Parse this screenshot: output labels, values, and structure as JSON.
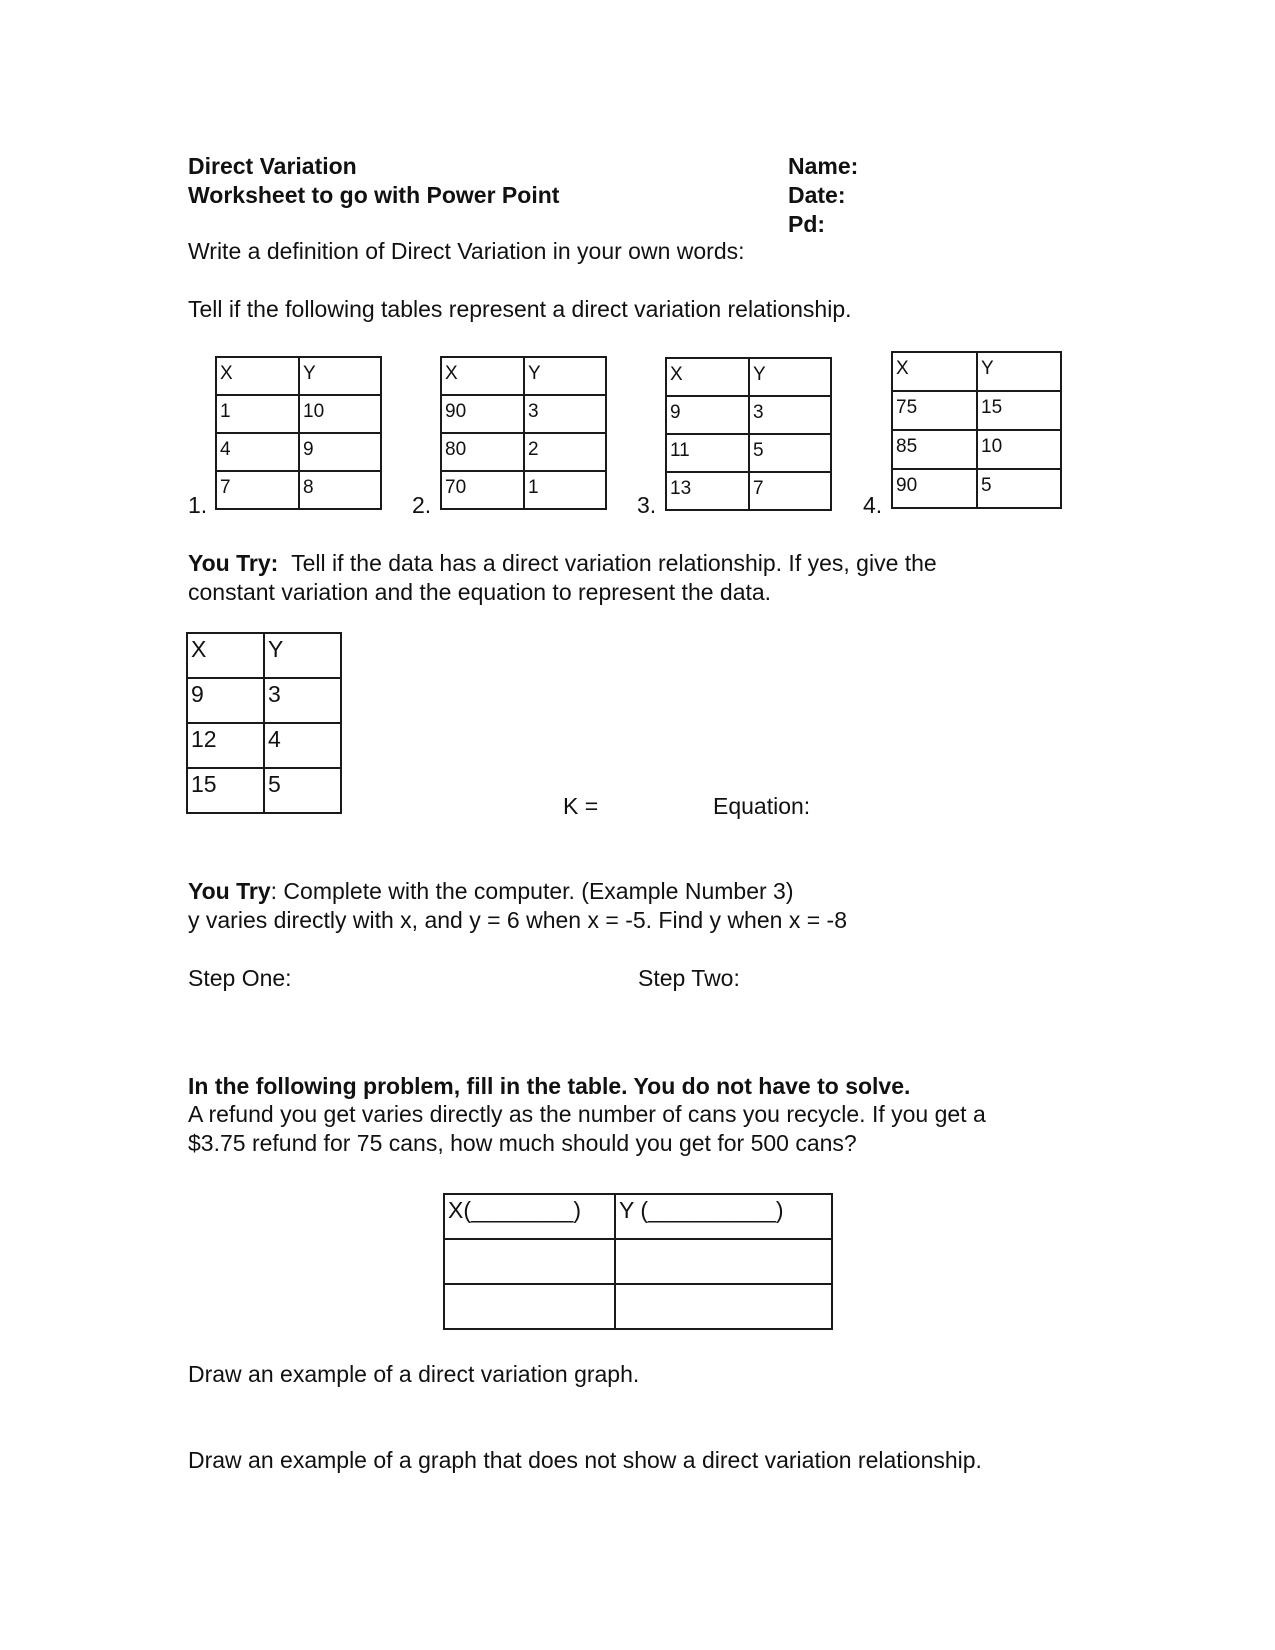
{
  "header": {
    "title": "Direct Variation",
    "subtitle": "Worksheet to go with Power Point",
    "name_label": "Name:",
    "date_label": "Date:",
    "period_label": "Pd:"
  },
  "definition_prompt": "Write a definition of Direct Variation in your own words:",
  "tables_section": {
    "instruction": "Tell if the following tables represent a direct variation relationship.",
    "tables": [
      {
        "label": "1.",
        "headers": [
          "X",
          "Y"
        ],
        "rows": [
          [
            "1",
            "10"
          ],
          [
            "4",
            "9"
          ],
          [
            "7",
            "8"
          ]
        ]
      },
      {
        "label": "2.",
        "headers": [
          "X",
          "Y"
        ],
        "rows": [
          [
            "90",
            "3"
          ],
          [
            "80",
            "2"
          ],
          [
            "70",
            "1"
          ]
        ]
      },
      {
        "label": "3.",
        "headers": [
          "X",
          "Y"
        ],
        "rows": [
          [
            "9",
            "3"
          ],
          [
            "11",
            "5"
          ],
          [
            "13",
            "7"
          ]
        ]
      },
      {
        "label": "4.",
        "headers": [
          "X",
          "Y"
        ],
        "rows": [
          [
            "75",
            "15"
          ],
          [
            "85",
            "10"
          ],
          [
            "90",
            "5"
          ]
        ]
      }
    ]
  },
  "you_try_1": {
    "lead": "You Try:",
    "line1": "Tell if the data has a direct variation relationship.  If yes, give the",
    "line2": "constant variation and the equation to represent the data.",
    "table": {
      "headers": [
        "X",
        "Y"
      ],
      "rows": [
        [
          "9",
          "3"
        ],
        [
          "12",
          "4"
        ],
        [
          "15",
          "5"
        ]
      ]
    },
    "k_label": "K =",
    "equation_label": "Equation:"
  },
  "you_try_2": {
    "lead": "You Try",
    "line1": ":  Complete with the computer. (Example Number 3)",
    "line2": "y varies directly with x, and y = 6 when x = -5.  Find y when x = -8",
    "step_one": "Step One:",
    "step_two": "Step Two:"
  },
  "refund_problem": {
    "heading": "In the following problem, fill in the table.  You do not have to solve.",
    "line1": "A refund you get varies directly as the number of cans you recycle.  If you get a",
    "line2": "$3.75 refund for 75 cans, how much should you get for 500 cans?",
    "table": {
      "headers": [
        "X(________)",
        "Y (__________)"
      ],
      "rows": [
        [
          "",
          ""
        ],
        [
          "",
          ""
        ]
      ]
    }
  },
  "graph_prompts": {
    "direct": "Draw an example of a direct variation graph.",
    "not_direct": "Draw an example of a graph that does not show a direct variation relationship."
  }
}
